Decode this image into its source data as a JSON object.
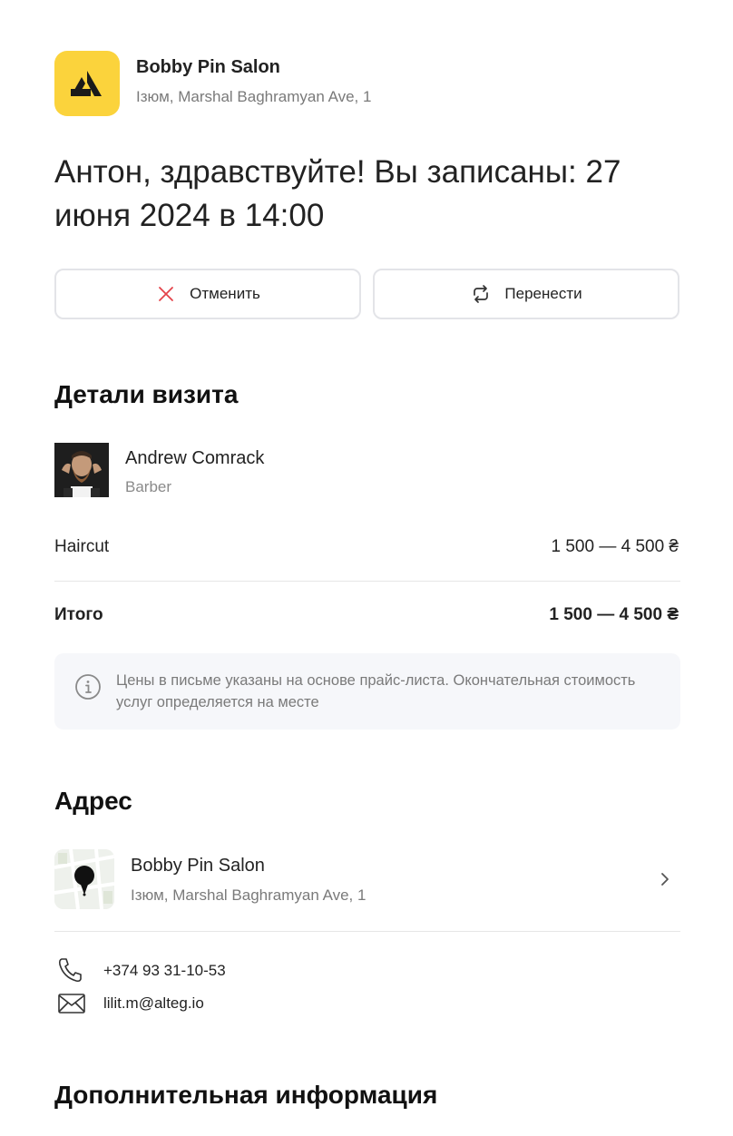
{
  "salon": {
    "name": "Bobby Pin Salon",
    "address": "Ізюм, Marshal Baghramyan Ave, 1",
    "brand_color": "#fbd33c"
  },
  "greeting": "Антон, здравствуйте! Вы записаны: 27 июня 2024 в 14:00",
  "actions": {
    "cancel_label": "Отменить",
    "reschedule_label": "Перенести"
  },
  "visit": {
    "heading": "Детали визита",
    "staff_name": "Andrew Comrack",
    "staff_role": "Barber",
    "service_name": "Haircut",
    "service_price": "1 500 — 4 500 ₴",
    "total_label": "Итого",
    "total_price": "1 500 — 4 500 ₴",
    "notice": "Цены в письме указаны на основе прайс-листа. Окончательная стоимость услуг определяется на месте"
  },
  "address_section": {
    "heading": "Адрес",
    "name": "Bobby Pin Salon",
    "address": "Ізюм, Marshal Baghramyan Ave, 1"
  },
  "contacts": {
    "phone": "+374 93 31-10-53",
    "email": "lilit.m@alteg.io"
  },
  "extra": {
    "heading": "Дополнительная информация"
  },
  "icons": [
    "logo-mark-icon",
    "close-icon",
    "refresh-icon",
    "info-icon",
    "map-pin-icon",
    "chevron-right-icon",
    "phone-icon",
    "mail-icon"
  ]
}
